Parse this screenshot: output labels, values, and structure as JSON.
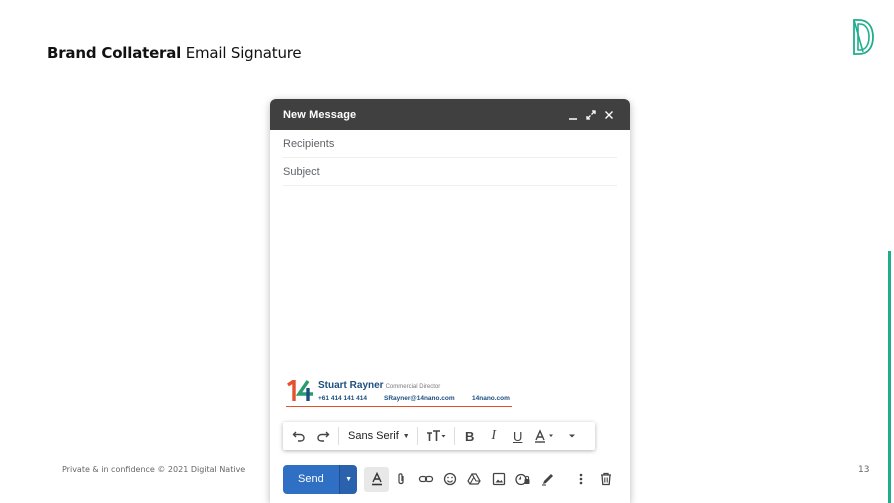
{
  "slide": {
    "title_bold": "Brand Collateral",
    "title_rest": " Email Signature",
    "footer": "Private & in confidence © 2021 Digital Native",
    "page_number": "13",
    "accent_color": "#1fae8c"
  },
  "compose": {
    "title": "New Message",
    "recipients_placeholder": "Recipients",
    "subject_placeholder": "Subject",
    "header_icons": [
      "minimize-icon",
      "expand-icon",
      "close-icon"
    ],
    "header_color": "#404040"
  },
  "signature": {
    "name": "Stuart Rayner",
    "role": "Commercial Director",
    "phone": "+61 414 141 414",
    "email": "SRayner@14nano.com",
    "website": "14nano.com",
    "name_color": "#1c4f80",
    "line_color": "#e5502d"
  },
  "format_toolbar": {
    "font": "Sans Serif",
    "icons": [
      "undo-icon",
      "redo-icon",
      "font-size-icon",
      "bold-icon",
      "italic-icon",
      "underline-icon",
      "text-color-icon",
      "more-formatting-icon"
    ]
  },
  "bottom_toolbar": {
    "send_label": "Send",
    "send_color": "#2f6fc4",
    "icons": [
      "formatting-options-icon",
      "attach-icon",
      "link-icon",
      "emoji-icon",
      "drive-icon",
      "photo-icon",
      "confidential-icon",
      "signature-icon",
      "more-options-icon",
      "discard-icon"
    ]
  }
}
